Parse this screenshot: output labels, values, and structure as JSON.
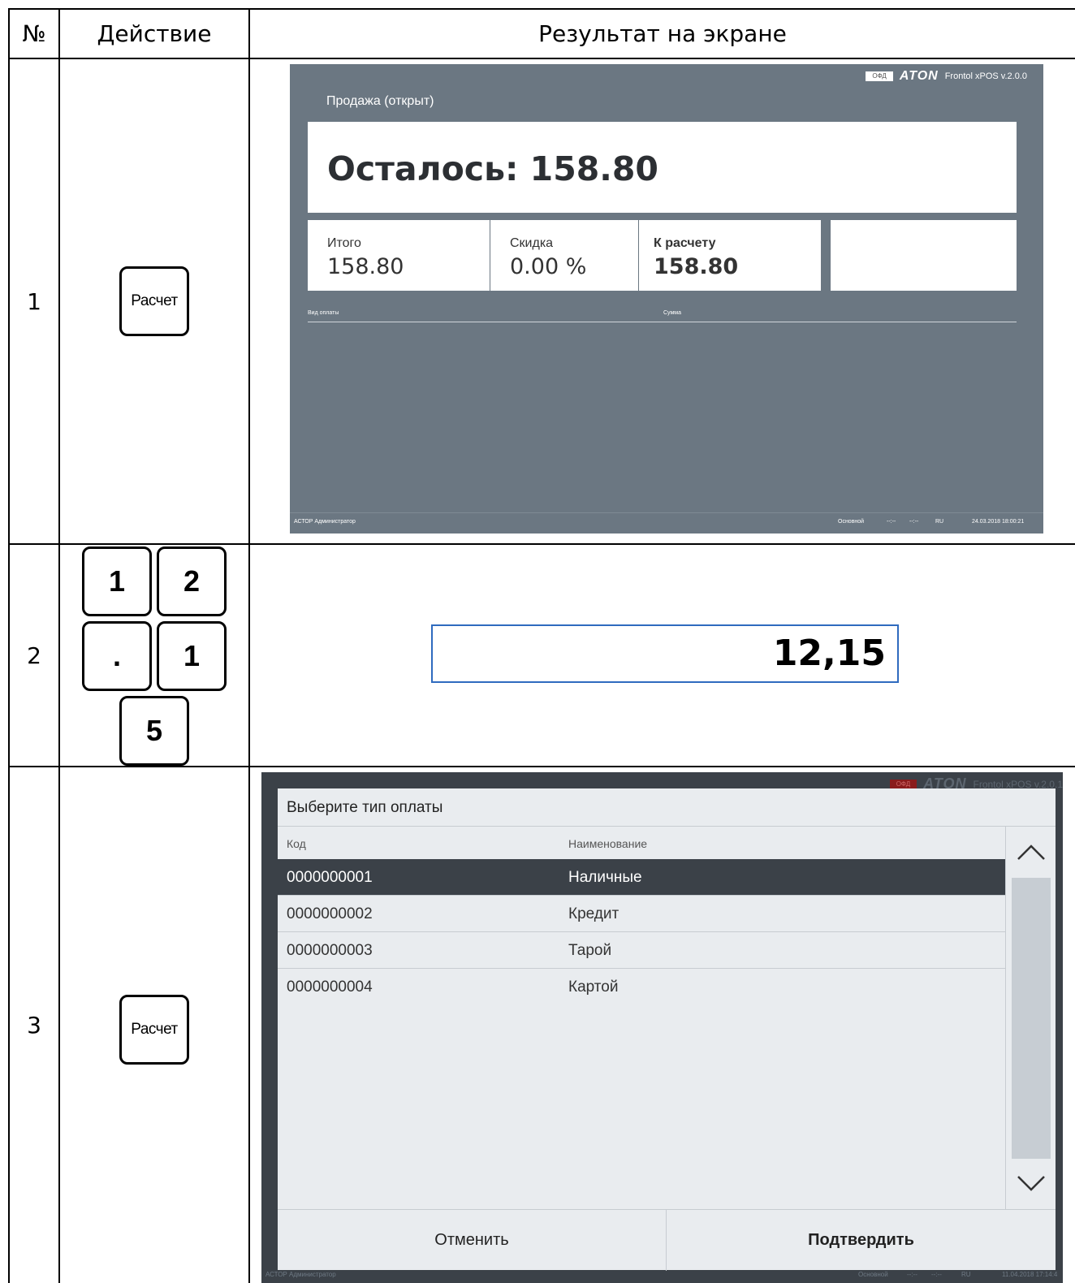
{
  "table": {
    "headers": [
      "№",
      "Действие",
      "Результат на экране"
    ],
    "rows": [
      {
        "num": "1",
        "key_label": "Расчет"
      },
      {
        "num": "2",
        "keys": [
          "1",
          "2",
          ".",
          "1",
          "5"
        ]
      },
      {
        "num": "3",
        "key_label": "Расчет"
      }
    ]
  },
  "screen1": {
    "brand_ofd": "ОФД",
    "brand_logo": "ATON",
    "brand_version": "Frontol xPOS v.2.0.0",
    "status": "Продажа (открыт)",
    "remaining": "Осталось: 158.80",
    "total_label": "Итого",
    "total_value": "158.80",
    "discount_label": "Скидка",
    "discount_value": "0.00 %",
    "due_label": "К расчету",
    "due_value": "158.80",
    "col_payment_type": "Вид оплаты",
    "col_sum": "Сумма",
    "footer_left": "АСТОР  Администратор",
    "footer_mode": "Основной",
    "footer_t1": "--:--",
    "footer_t2": "--:--",
    "footer_lang": "RU",
    "footer_datetime": "24.03.2018 18:00:21"
  },
  "screen2": {
    "input_value": "12,15"
  },
  "screen3": {
    "brand_ofd": "ОФД",
    "brand_logo": "ATON",
    "brand_version": "Frontol xPOS v.2.0.1",
    "dialog_title": "Выберите тип оплаты",
    "col_code": "Код",
    "col_name": "Наименование",
    "items": [
      {
        "code": "0000000001",
        "name": "Наличные"
      },
      {
        "code": "0000000002",
        "name": "Кредит"
      },
      {
        "code": "0000000003",
        "name": "Тарой"
      },
      {
        "code": "0000000004",
        "name": "Картой"
      }
    ],
    "cancel_label": "Отменить",
    "confirm_label": "Подтвердить",
    "footer_left": "АСТОР  Администратор",
    "footer_mode": "Основной",
    "footer_t1": "--:--",
    "footer_t2": "--:--",
    "footer_lang": "RU",
    "footer_datetime": "11.04.2018 17:14:4"
  },
  "colors": {
    "screen1_bg": "#6b7782",
    "screen3_bg": "#3b4148",
    "input_border": "#2f6bbf",
    "selected_row": "#3b4148"
  }
}
